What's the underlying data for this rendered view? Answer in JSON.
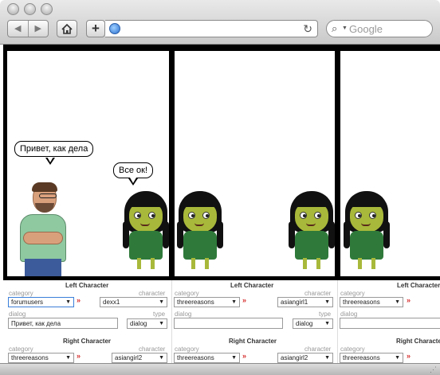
{
  "browser": {
    "search_placeholder": "Google",
    "url": ""
  },
  "comic": {
    "panel1": {
      "left_dialog": "Привет, как дела",
      "right_dialog": "Все ок!"
    }
  },
  "editor": {
    "left_title": "Left Character",
    "right_title": "Right Character",
    "category_label": "category",
    "character_label": "character",
    "dialog_label": "dialog",
    "type_label": "type",
    "panels": [
      {
        "left": {
          "category": "forumusers",
          "character": "dexx1",
          "dialog": "Привет, как дела",
          "type": "dialog"
        },
        "right": {
          "category": "threereasons",
          "character": "asiangirl2"
        }
      },
      {
        "left": {
          "category": "threereasons",
          "character": "asiangirl1",
          "dialog": "",
          "type": "dialog"
        },
        "right": {
          "category": "threereasons",
          "character": "asiangirl2"
        }
      },
      {
        "left": {
          "category": "threereasons",
          "character": "",
          "dialog": "",
          "type": ""
        },
        "right": {
          "category": "threereasons",
          "character": ""
        }
      }
    ]
  },
  "icons": {
    "back": "back-arrow-icon",
    "forward": "forward-arrow-icon",
    "home": "home-icon",
    "add": "plus-icon",
    "globe": "globe-icon",
    "reload": "reload-icon",
    "search": "magnifier-icon"
  },
  "colors": {
    "accent_red": "#d52a2a",
    "girl_shirt": "#2f7a3a",
    "man_shirt": "#8ec9a0"
  }
}
